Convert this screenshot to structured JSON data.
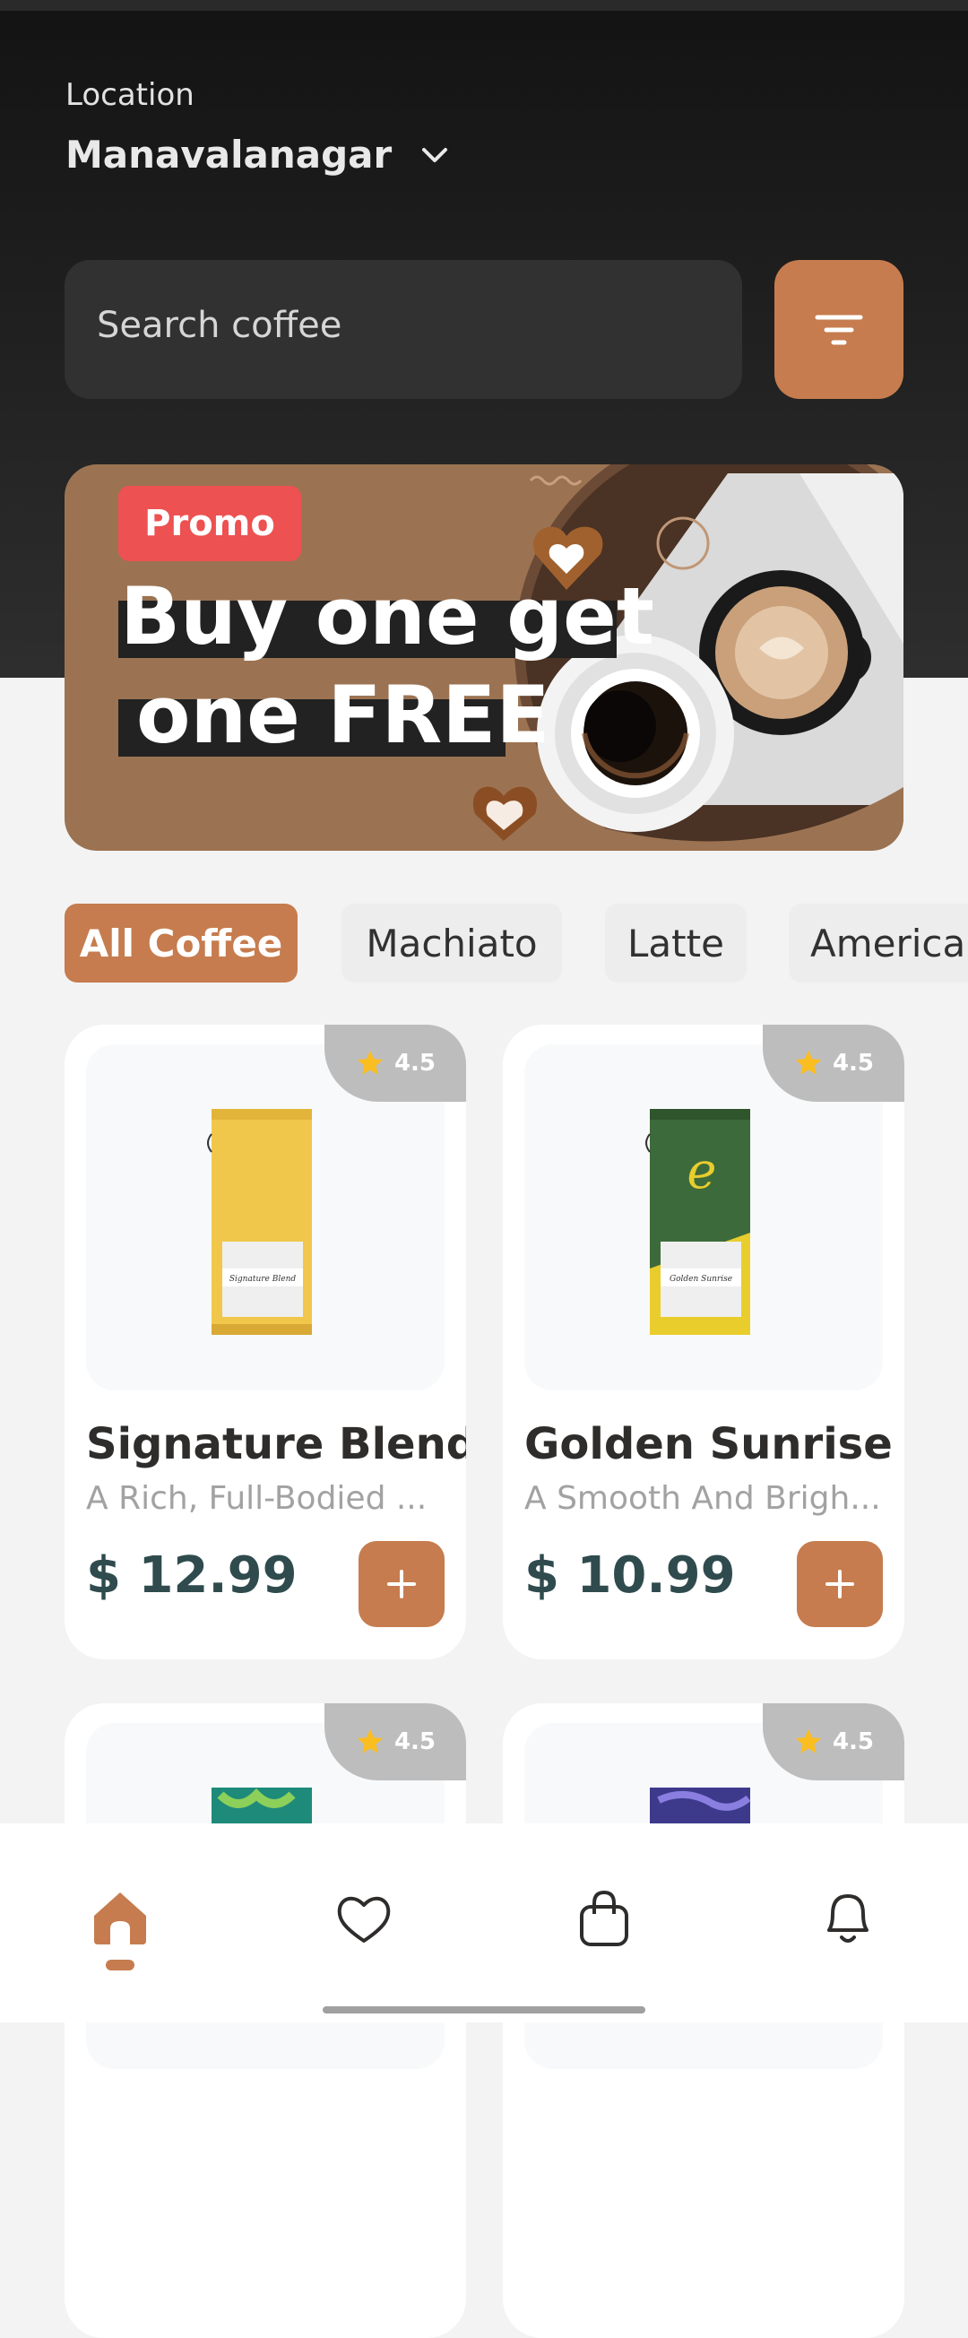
{
  "header": {
    "location_label": "Location",
    "location_value": "Manavalanagar"
  },
  "search": {
    "placeholder": "Search coffee"
  },
  "promo": {
    "badge": "Promo",
    "line1": "Buy one get",
    "line2": "one FREE"
  },
  "categories": [
    "All Coffee",
    "Machiato",
    "Latte",
    "America"
  ],
  "products": [
    {
      "rating": "4.5",
      "name": "Signature Blend",
      "desc": "A Rich, Full-Bodied ...",
      "price": "$ 12.99",
      "label": "Signature Blend"
    },
    {
      "rating": "4.5",
      "name": "Golden Sunrise",
      "desc": "A Smooth And Brigh...",
      "price": "$ 10.99",
      "label": "Golden Sunrise"
    },
    {
      "rating": "4.5"
    },
    {
      "rating": "4.5"
    }
  ],
  "colors": {
    "accent": "#C67C4E",
    "promo_badge": "#ED5151",
    "star": "#FBBE21"
  },
  "icons": [
    "chevron-down-icon",
    "filter-icon",
    "star-icon",
    "plus-icon",
    "home-icon",
    "heart-icon",
    "bag-icon",
    "bell-icon"
  ]
}
